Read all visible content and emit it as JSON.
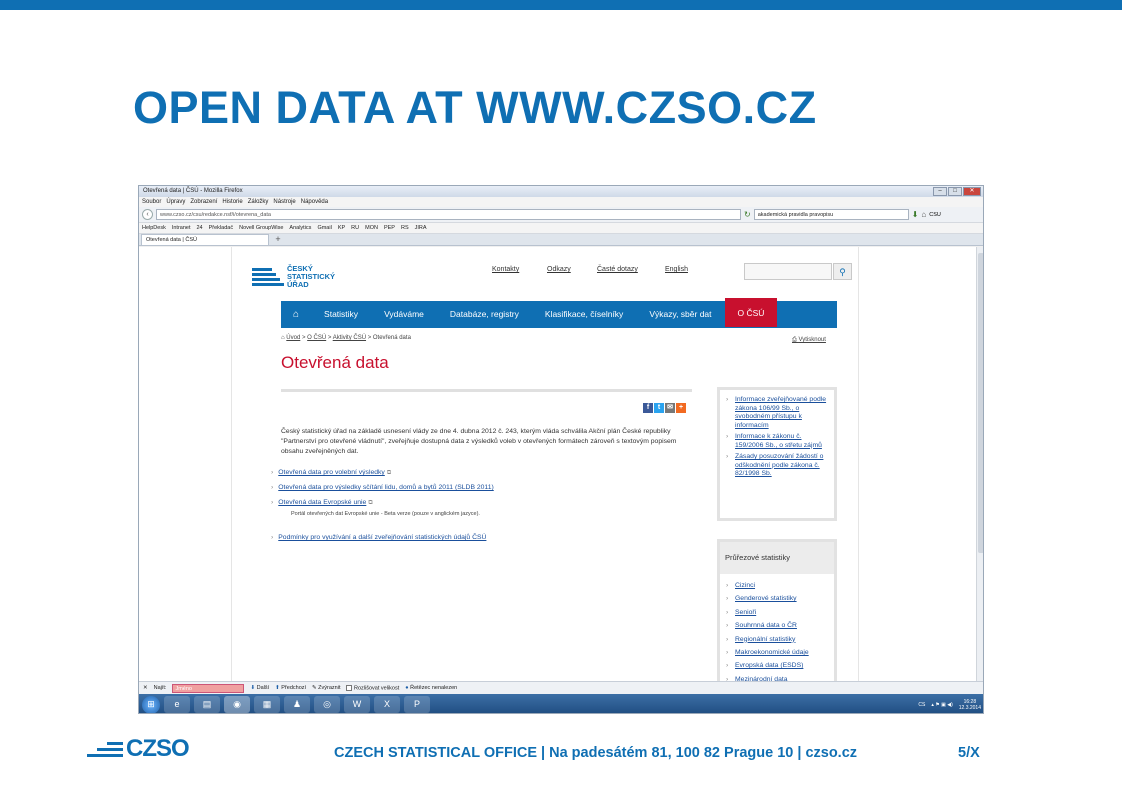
{
  "slide": {
    "title": "OPEN DATA AT WWW.CZSO.CZ",
    "footer": "CZECH STATISTICAL OFFICE | Na padesátém 81, 100 82 Prague 10 | czso.cz",
    "page_number": "5/X",
    "footer_logo": "CZSO"
  },
  "browser": {
    "window_title": "Otevřená data | ČSÚ - Mozilla Firefox",
    "menu": [
      "Soubor",
      "Úpravy",
      "Zobrazení",
      "Historie",
      "Záložky",
      "Nástroje",
      "Nápověda"
    ],
    "url": "www.czso.cz/csu/redakce.nsf/i/otevrena_data",
    "search_value": "akademická pravidla pravopisu",
    "search_engine": "CSU",
    "bookmarks": [
      "HelpDesk",
      "Intranet",
      "24",
      "Překladač",
      "Novell GroupWise",
      "Analytics",
      "Gmail",
      "KP",
      "RU",
      "MON",
      "PEP",
      "RS",
      "JIRA"
    ],
    "tab_label": "Otevřená data | ČSÚ"
  },
  "site": {
    "logo_lines": [
      "ČESKÝ",
      "STATISTICKÝ",
      "ÚŘAD"
    ],
    "top_links": [
      "Kontakty",
      "Odkazy",
      "Časté dotazy",
      "English"
    ],
    "nav": [
      "Statistiky",
      "Vydáváme",
      "Databáze, registry",
      "Klasifikace, číselníky",
      "Výkazy, sběr dat",
      "O ČSÚ"
    ],
    "breadcrumb": [
      "Úvod",
      "O ČSÚ",
      "Aktivity ČSÚ",
      "Otevřená data"
    ],
    "print_label": "Vytisknout",
    "heading": "Otevřená data",
    "intro": "Český statistický úřad na základě usnesení vlády ze dne 4. dubna 2012 č. 243, kterým vláda schválila Akční plán České republiky \"Partnerství pro otevřené vládnutí\", zveřejňuje dostupná data z výsledků voleb v otevřených formátech zároveň s textovým popisem obsahu zveřejněných dat.",
    "data_links": [
      "Otevřená data pro volební výsledky",
      "Otevřená data pro výsledky sčítání lidu, domů a bytů 2011 (SLDB 2011)",
      "Otevřená data Evropské unie"
    ],
    "eu_note": "Portál otevřených dat Evropské unie - Beta verze (pouze v anglickém jazyce).",
    "conditions_link": "Podmínky pro využívání a další zveřejňování statistických údajů ČSÚ",
    "side_links": [
      "Informace zveřejňované podle zákona 106/99 Sb., o svobodném přístupu k informacím",
      "Informace k zákonu č. 159/2006 Sb., o střetu zájmů",
      "Zásady posuzování žádostí o odškodnění podle zákona č. 82/1998 Sb."
    ],
    "cross_heading": "Průřezové statistiky",
    "cross_links": [
      "Cizinci",
      "Genderové statistiky",
      "Senioři",
      "Souhrnná data o ČR",
      "Regionální statistiky",
      "Makroekonomické údaje",
      "Evropská data (ESDS)",
      "Mezinárodní data"
    ]
  },
  "findbar": {
    "label": "Najít:",
    "value": "Jméno",
    "next": "Další",
    "prev": "Předchozí",
    "highlight": "Zvýraznit",
    "match_case": "Rozlišovat velikost",
    "status": "Řetězec nenalezen"
  },
  "taskbar": {
    "lang": "CS",
    "time": "16:28",
    "date": "12.3.2014"
  },
  "colors": {
    "brand_blue": "#0f6fb3",
    "accent_red": "#c8102e"
  }
}
